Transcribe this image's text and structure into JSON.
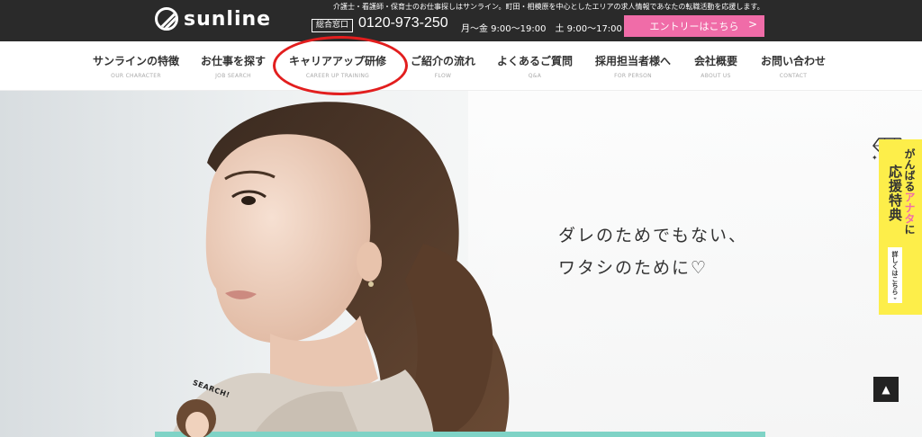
{
  "brand": {
    "name": "sunline"
  },
  "topbar": {
    "tagline": "介護士・看護師・保育士のお仕事探しはサンライン。町田・相模原を中心としたエリアの求人情報であなたの転職活動を応援します。",
    "phone_label": "総合窓口",
    "phone": "0120-973-250",
    "hours": "月〜金 9:00〜19:00　土 9:00〜17:00",
    "entry_label": "エントリーはこちら",
    "entry_chevron": ">"
  },
  "nav": [
    {
      "jp": "サンラインの特徴",
      "en": "OUR CHARACTER"
    },
    {
      "jp": "お仕事を探す",
      "en": "JOB SEARCH"
    },
    {
      "jp": "キャリアアップ研修",
      "en": "CAREER UP TRAINING"
    },
    {
      "jp": "ご紹介の流れ",
      "en": "FLOW"
    },
    {
      "jp": "よくあるご質問",
      "en": "Q&A"
    },
    {
      "jp": "採用担当者様へ",
      "en": "FOR PERSON"
    },
    {
      "jp": "会社概要",
      "en": "ABOUT US"
    },
    {
      "jp": "お問い合わせ",
      "en": "CONTACT"
    }
  ],
  "hero": {
    "line1": "ダレのためでもない、",
    "line2": "ワタシのために♡"
  },
  "side_banner": {
    "sub_a": "がんばる",
    "sub_pink": "アナタ",
    "sub_b": "に",
    "title": "応援特典",
    "link": "詳しくはこちら ›"
  },
  "search_badge": "SEARCH!",
  "colors": {
    "topbar": "#2a2a2a",
    "entry": "#f06ca8",
    "banner": "#fdee4a",
    "highlight": "#e21e1e",
    "teal": "#7fd3c6"
  }
}
